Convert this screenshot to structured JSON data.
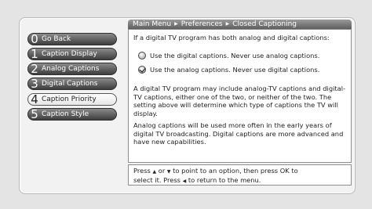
{
  "breadcrumb": [
    "Main Menu",
    "Preferences",
    "Closed Captioning"
  ],
  "menu": {
    "items": [
      {
        "number": "0",
        "label": "Go Back"
      },
      {
        "number": "1",
        "label": "Caption Display"
      },
      {
        "number": "2",
        "label": "Analog Captions"
      },
      {
        "number": "3",
        "label": "Digital Captions"
      },
      {
        "number": "4",
        "label": "Caption Priority"
      },
      {
        "number": "5",
        "label": "Caption Style"
      }
    ],
    "selected": "Caption Priority"
  },
  "content": {
    "question": "If a digital TV program has both analog and digital captions:",
    "options": [
      {
        "label": "Use the digital captions. Never use analog captions.",
        "checked": false
      },
      {
        "label": "Use the analog captions. Never use digital captions.",
        "checked": true
      }
    ],
    "paragraph1": "A digital TV program may include analog-TV captions and digital-TV captions, either one of the two, or neither of the two. The setting above will determine which type of captions the TV will display.",
    "paragraph2": "Analog captions will be used more often in the early years of digital TV broadcasting. Digital captions are more advanced and have new capabilities."
  },
  "help": {
    "press1": "Press",
    "or": "or",
    "to_point": "to point to an option, then press OK to",
    "select_it": "select it. Press",
    "to_return": "to return to the menu."
  },
  "icons": {
    "separator": "triangle-right-icon",
    "up": "triangle-up-icon",
    "down": "triangle-down-icon",
    "left": "triangle-left-icon"
  }
}
